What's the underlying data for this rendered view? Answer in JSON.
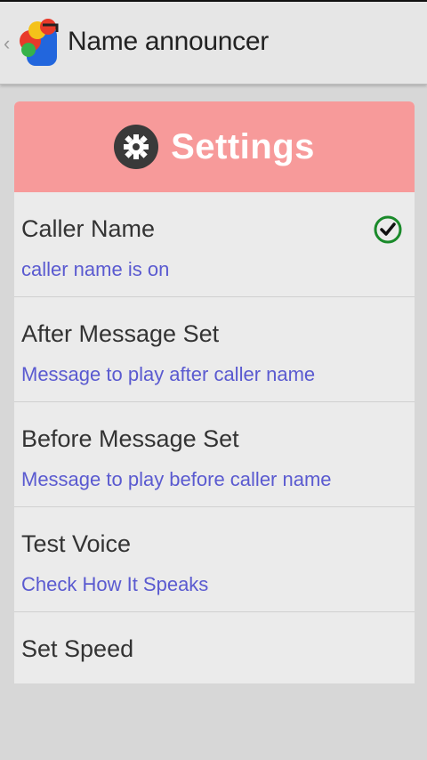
{
  "app": {
    "title": "Name announcer"
  },
  "settings": {
    "header": "Settings",
    "items": [
      {
        "title": "Caller Name",
        "subtitle": "caller name is on",
        "checked": true
      },
      {
        "title": "After Message Set",
        "subtitle": "Message to play after caller name"
      },
      {
        "title": "Before Message Set",
        "subtitle": "Message to play before caller name"
      },
      {
        "title": "Test Voice",
        "subtitle": "Check How It Speaks"
      },
      {
        "title": "Set Speed",
        "subtitle": ""
      }
    ]
  },
  "colors": {
    "header_bg": "#f79a9a",
    "subtitle": "#5a5ad0",
    "check": "#1a8a2a"
  }
}
